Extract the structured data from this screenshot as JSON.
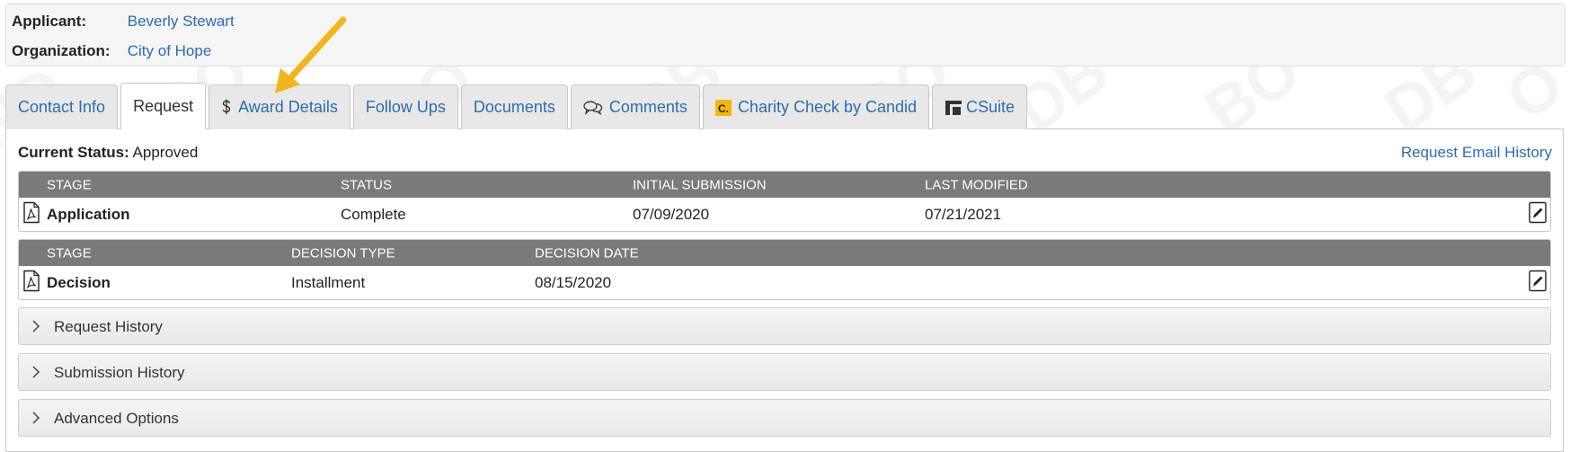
{
  "applicant": {
    "applicant_label": "Applicant:",
    "applicant_name": "Beverly Stewart",
    "organization_label": "Organization:",
    "organization_name": "City of Hope"
  },
  "tabs": [
    {
      "label": "Contact Info",
      "icon": null,
      "active": false
    },
    {
      "label": "Request",
      "icon": null,
      "active": true
    },
    {
      "label": "Award Details",
      "icon": "dollar-icon",
      "active": false
    },
    {
      "label": "Follow Ups",
      "icon": null,
      "active": false
    },
    {
      "label": "Documents",
      "icon": null,
      "active": false
    },
    {
      "label": "Comments",
      "icon": "comments-icon",
      "active": false
    },
    {
      "label": "Charity Check by Candid",
      "icon": "candid-logo-icon",
      "active": false
    },
    {
      "label": "CSuite",
      "icon": "csuite-logo-icon",
      "active": false
    }
  ],
  "status": {
    "label": "Current Status:",
    "value": "Approved",
    "email_history_link": "Request Email History"
  },
  "application_table": {
    "headers": [
      "STAGE",
      "STATUS",
      "INITIAL SUBMISSION",
      "LAST MODIFIED"
    ],
    "row": {
      "stage": "Application",
      "status": "Complete",
      "initial_submission": "07/09/2020",
      "last_modified": "07/21/2021"
    }
  },
  "decision_table": {
    "headers": [
      "STAGE",
      "DECISION TYPE",
      "DECISION DATE"
    ],
    "row": {
      "stage": "Decision",
      "decision_type": "Installment",
      "decision_date": "08/15/2020"
    }
  },
  "accordions": [
    "Request History",
    "Submission History",
    "Advanced Options"
  ],
  "colors": {
    "link": "#2a6db0",
    "table_header": "#7a7a7a",
    "annotation_arrow": "#f2b51c",
    "candid_logo": "#f5b800"
  }
}
